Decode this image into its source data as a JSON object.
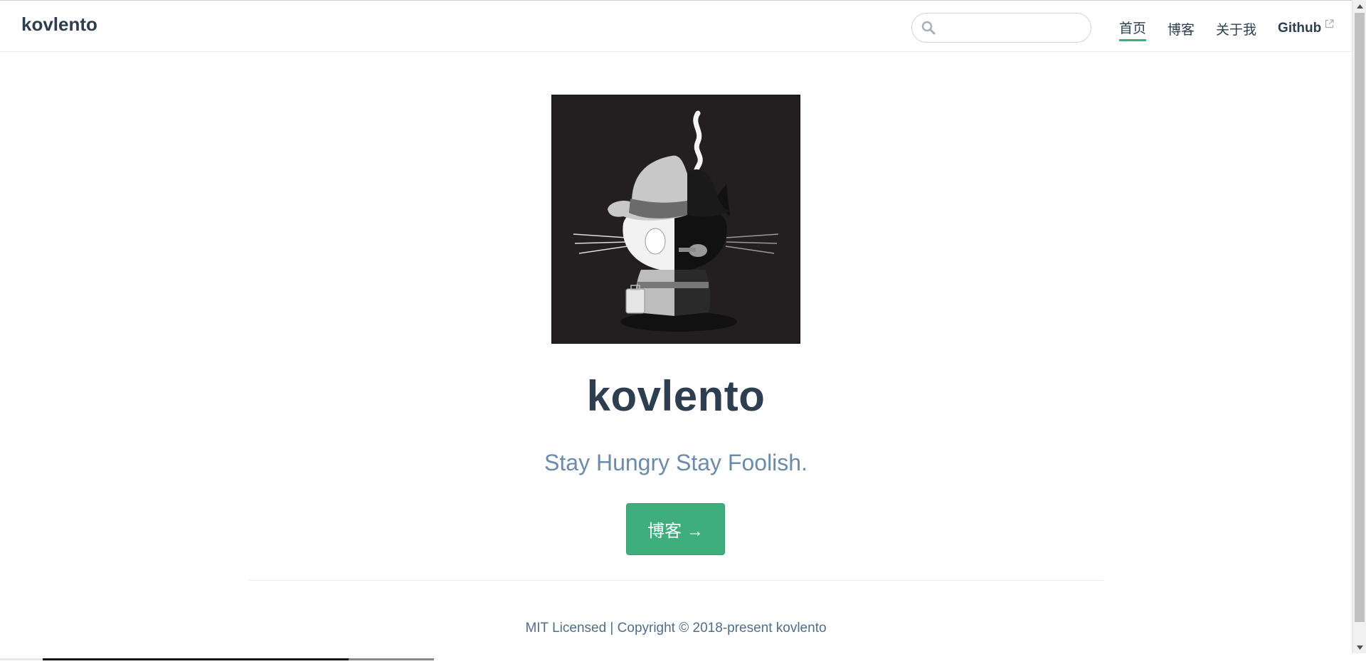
{
  "navbar": {
    "site_name": "kovlento",
    "search": {
      "value": "",
      "placeholder": ""
    },
    "links": [
      {
        "label": "首页",
        "active": true
      },
      {
        "label": "博客",
        "active": false
      },
      {
        "label": "关于我",
        "active": false
      },
      {
        "label": "Github",
        "active": false,
        "external": true
      }
    ]
  },
  "hero": {
    "image": "hero-image (smoking octocat with fedora, pipe and briefcase)",
    "title": "kovlento",
    "description": "Stay Hungry Stay Foolish.",
    "action_label": "博客 →"
  },
  "footer": {
    "text": "MIT Licensed | Copyright © 2018-present kovlento"
  },
  "colors": {
    "accent": "#3eaf7c",
    "text": "#2c3e50",
    "description": "#6a8bad",
    "hero_bg": "#231f20"
  },
  "icons": {
    "search": "search-icon",
    "external": "external-link-icon"
  }
}
